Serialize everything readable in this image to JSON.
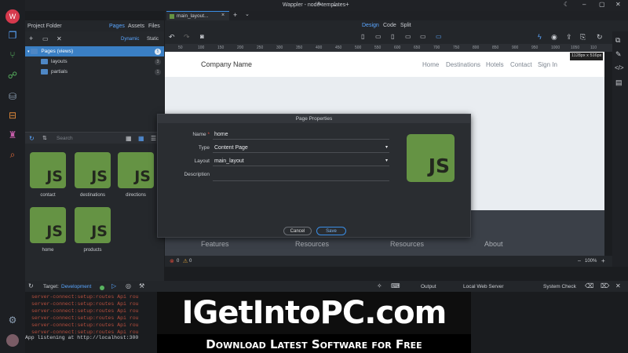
{
  "window": {
    "title": "Wappler - node-templates"
  },
  "project": {
    "header": "Project Folder",
    "tabs": [
      "Pages",
      "Assets",
      "Files"
    ],
    "modes": [
      "Dynamic",
      "Static"
    ],
    "tree": [
      {
        "label": "Pages (views)",
        "count": "5",
        "selected": true
      },
      {
        "label": "layouts",
        "count": "3"
      },
      {
        "label": "partials",
        "count": "1"
      }
    ],
    "search_placeholder": "Search",
    "files": [
      "contact",
      "destinations",
      "directions",
      "home",
      "products"
    ]
  },
  "editor": {
    "tab": "main_layout...",
    "views": [
      "Design",
      "Code",
      "Split"
    ],
    "ruler": [
      "50",
      "100",
      "150",
      "200",
      "250",
      "300",
      "350",
      "400",
      "450",
      "500",
      "550",
      "600",
      "650",
      "700",
      "750",
      "800",
      "850",
      "900",
      "950",
      "1000",
      "1050",
      "110"
    ],
    "size_badge": "1128px x 516px",
    "zoom": "100%",
    "errors": "0",
    "warnings": "0"
  },
  "site": {
    "brand": "Company Name",
    "nav": [
      "Home",
      "Destinations",
      "Hotels",
      "Contact",
      "Sign In"
    ],
    "footer": [
      "Features",
      "Resources",
      "Resources",
      "About"
    ]
  },
  "modal": {
    "title": "Page Properties",
    "name_label": "Name",
    "name_value": "home",
    "type_label": "Type",
    "type_value": "Content Page",
    "layout_label": "Layout",
    "layout_value": "main_layout",
    "description_label": "Description",
    "cancel": "Cancel",
    "save": "Save"
  },
  "bottom": {
    "target_label": "Target:",
    "target_value": "Development",
    "output": "Output",
    "server": "Local Web Server",
    "system_check": "System Check"
  },
  "console": {
    "lines": [
      "server-connect:setup:routes Api rou",
      "server-connect:setup:routes Api rou",
      "server-connect:setup:routes Api rou",
      "server-connect:setup:routes Api rou",
      "server-connect:setup:routes Api rou",
      "server-connect:setup:routes Api rou"
    ],
    "last": "App listening at http://localhost:300"
  },
  "watermark": {
    "main": "IGetIntoPC.com",
    "sub": "Download Latest Software for Free"
  },
  "colors": {
    "accent": "#3a8ee6",
    "js": "#659344",
    "error": "#e04a3a"
  }
}
